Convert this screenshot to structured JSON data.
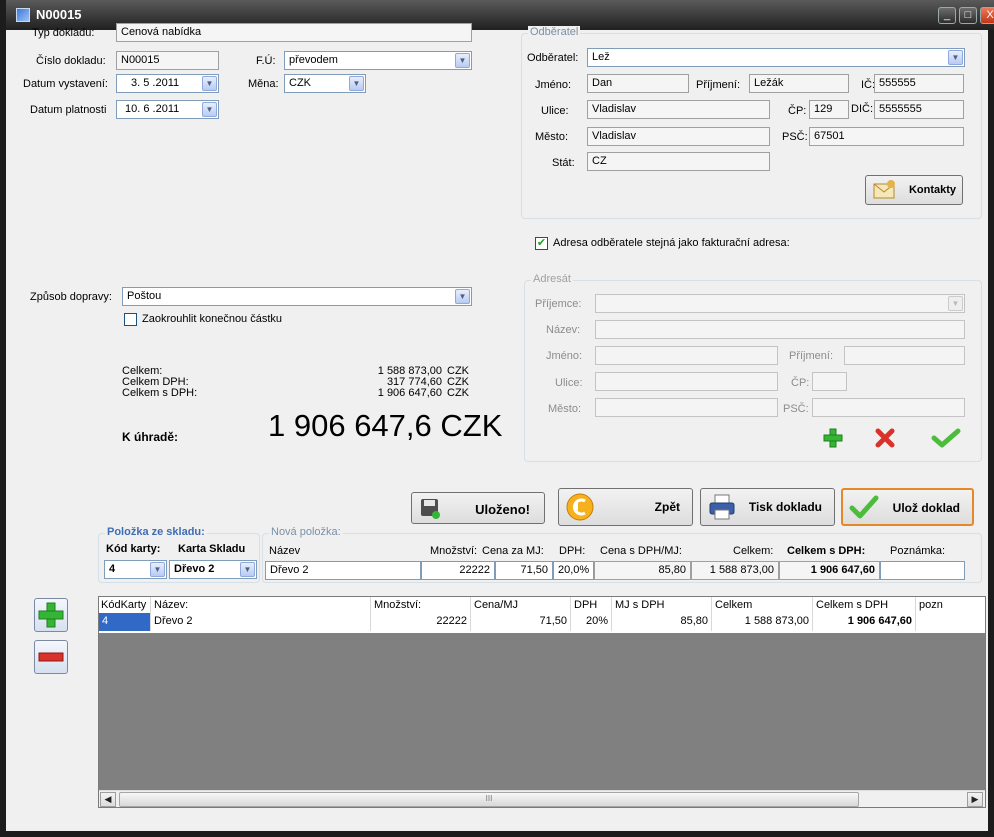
{
  "window": {
    "title": "N00015",
    "min": "_",
    "max": "□",
    "close": "X"
  },
  "doc": {
    "typ_label": "Typ dokladu:",
    "typ_value": "Cenová nabídka",
    "cislo_label": "Číslo dokladu:",
    "cislo_value": "N00015",
    "fu_label": "F.Ú:",
    "fu_value": "převodem",
    "datum_vyst_label": "Datum vystavení:",
    "datum_vyst_value": "3. 5 .2011",
    "mena_label": "Měna:",
    "mena_value": "CZK",
    "datum_plat_label": "Datum platnosti",
    "datum_plat_value": "10. 6 .2011"
  },
  "odberatel": {
    "group_title": "Odběratel",
    "odberatel_label": "Odběratel:",
    "odberatel_value": "Lež",
    "jmeno_label": "Jméno:",
    "jmeno_value": "Dan",
    "prijmeni_label": "Příjmení:",
    "prijmeni_value": "Ležák",
    "ic_label": "IČ:",
    "ic_value": "555555",
    "ulice_label": "Ulice:",
    "ulice_value": "Vladislav",
    "cp_label": "ČP:",
    "cp_value": "129",
    "dic_label": "DIČ:",
    "dic_value": "5555555",
    "mesto_label": "Město:",
    "mesto_value": "Vladislav",
    "psc_label": "PSČ:",
    "psc_value": "67501",
    "stat_label": "Stát:",
    "stat_value": "CZ",
    "kontakty_label": "Kontakty"
  },
  "adresa_check": {
    "label": "Adresa odběratele stejná jako fakturační adresa:",
    "checked": true
  },
  "adresat": {
    "group_title": "Adresát",
    "prijemce_label": "Příjemce:",
    "nazev_label": "Název:",
    "jmeno_label": "Jméno:",
    "prijmeni_label": "Příjmení:",
    "ulice_label": "Ulice:",
    "cp_label": "ČP:",
    "mesto_label": "Město:",
    "psc_label": "PSČ:"
  },
  "doprava": {
    "label": "Způsob dopravy:",
    "value": "Poštou",
    "zaokrouhlit_label": "Zaokrouhlit konečnou částku"
  },
  "totals": {
    "celkem_label": "Celkem:",
    "celkem_value": "1 588 873,00",
    "celkem_cur": "CZK",
    "dph_label": "Celkem DPH:",
    "dph_value": "317 774,60",
    "dph_cur": "CZK",
    "sdph_label": "Celkem s DPH:",
    "sdph_value": "1 906 647,60",
    "sdph_cur": "CZK",
    "uhrade_label": "K úhradě:",
    "uhrade_value": "1 906 647,6 CZK"
  },
  "buttons": {
    "ulozeno": "Uloženo!",
    "zpet": "Zpět",
    "tisk": "Tisk dokladu",
    "uloz": "Ulož doklad"
  },
  "polozka_sklad": {
    "title": "Položka ze skladu:",
    "kod_label": "Kód karty:",
    "karta_label": "Karta Skladu",
    "kod_value": "4",
    "karta_value": "Dřevo 2"
  },
  "nova_polozka": {
    "title": "Nová položka:",
    "headers": {
      "nazev": "Název",
      "mnozstvi": "Množství:",
      "cena": "Cena za MJ:",
      "dph": "DPH:",
      "cena_dph": "Cena s DPH/MJ:",
      "celkem": "Celkem:",
      "celkem_dph": "Celkem s DPH:",
      "poznamka": "Poznámka:"
    },
    "values": {
      "nazev": "Dřevo 2",
      "mnozstvi": "22222",
      "cena": "71,50",
      "dph": "20,0%",
      "cena_dph": "85,80",
      "celkem": "1 588 873,00",
      "celkem_dph": "1 906 647,60",
      "poznamka": ""
    }
  },
  "grid": {
    "columns": [
      "KódKarty",
      "Název:",
      "Množství:",
      "Cena/MJ",
      "DPH",
      "MJ s DPH",
      "Celkem",
      "Celkem s DPH",
      "pozn"
    ],
    "rows": [
      [
        "4",
        "Dřevo 2",
        "22222",
        "71,50",
        "20%",
        "85,80",
        "1 588 873,00",
        "1 906 647,60",
        ""
      ]
    ],
    "scroll_grip": "III"
  },
  "side_buttons": {
    "add": "+",
    "remove": "−"
  },
  "colors": {
    "green": "#35b535",
    "red": "#d8322b",
    "selection": "#3169c6"
  }
}
